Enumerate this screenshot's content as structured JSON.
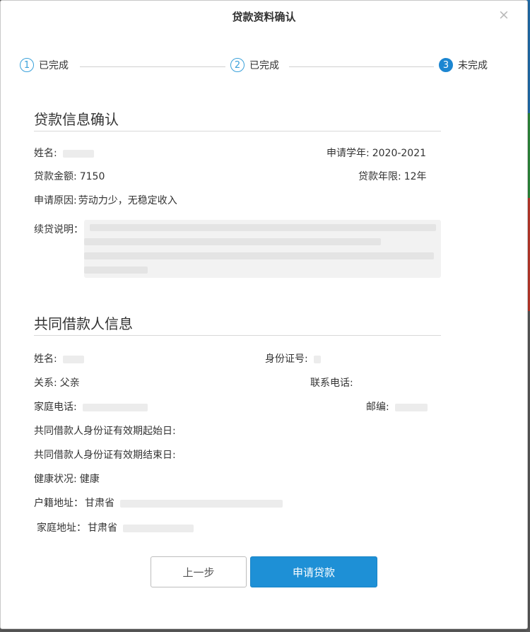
{
  "dialog": {
    "title": "贷款资料确认",
    "close_symbol": "×"
  },
  "steps": [
    {
      "number": "1",
      "label": "已完成"
    },
    {
      "number": "2",
      "label": "已完成"
    },
    {
      "number": "3",
      "label": "未完成"
    }
  ],
  "loan_info": {
    "section_title": "贷款信息确认",
    "name_label": "姓名:",
    "name_value": "",
    "academic_year_label": "申请学年:",
    "academic_year_value": "2020-2021",
    "amount_label": "贷款金额:",
    "amount_value": "7150",
    "term_label": "贷款年限:",
    "term_value": "12年",
    "reason_label": "申请原因:",
    "reason_value": "劳动力少，无稳定收入",
    "renewal_label": "续贷说明："
  },
  "co_borrower": {
    "section_title": "共同借款人信息",
    "name_label": "姓名:",
    "id_number_label": "身份证号:",
    "relation_label": "关系:",
    "relation_value": "父亲",
    "phone_label": "联系电话:",
    "home_phone_label": "家庭电话:",
    "postcode_label": "邮编:",
    "id_start_label": "共同借款人身份证有效期起始日:",
    "id_end_label": "共同借款人身份证有效期结束日:",
    "health_label": "健康状况:",
    "health_value": "健康",
    "household_address_label": "户籍地址：",
    "household_address_value": "甘肃省",
    "home_address_label": "家庭地址：",
    "home_address_value": "甘肃省"
  },
  "buttons": {
    "prev_label": "上一步",
    "apply_label": "申请贷款"
  },
  "colors": {
    "accent": "#1e90d6",
    "step_done": "#3aa1da",
    "step_current": "#1c86d1"
  }
}
